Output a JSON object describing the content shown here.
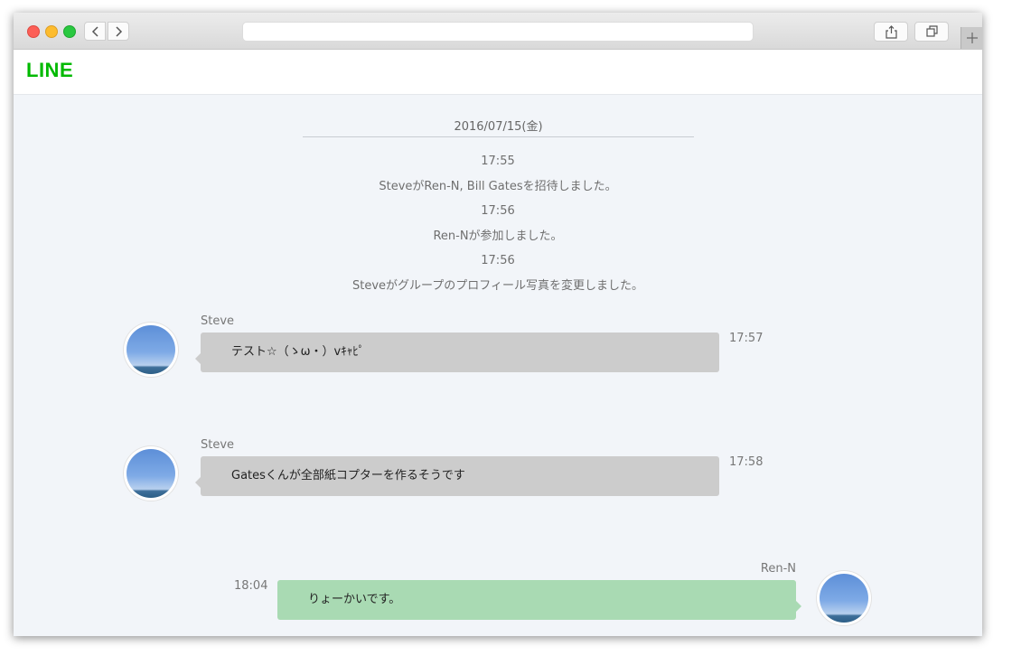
{
  "browser": {
    "url": "",
    "icons": [
      "chevron-left-icon",
      "chevron-right-icon",
      "share-icon",
      "tabs-icon",
      "plus-icon"
    ]
  },
  "app": {
    "logo": "LINE",
    "brand_color": "#00b900"
  },
  "chat": {
    "date": "2016/07/15(金)",
    "system_messages": [
      {
        "time": "17:55",
        "text": "SteveがRen-N, Bill Gatesを招待しました。"
      },
      {
        "time": "17:56",
        "text": "Ren-Nが参加しました。"
      },
      {
        "time": "17:56",
        "text": "Steveがグループのプロフィール写真を変更しました。"
      }
    ],
    "messages": [
      {
        "sender": "Steve",
        "text": "テスト☆（ゝω・）vｷｬﾋﾟ",
        "time": "17:57",
        "direction": "incoming"
      },
      {
        "sender": "Steve",
        "text": "Gatesくんが全部紙コプターを作るそうです",
        "time": "17:58",
        "direction": "incoming"
      },
      {
        "sender": "Ren-N",
        "text": "りょーかいです。",
        "time": "18:04",
        "direction": "outgoing"
      }
    ],
    "colors": {
      "incoming_bubble": "#cccccc",
      "outgoing_bubble": "#a9dab3",
      "background": "#f2f5f9"
    }
  }
}
